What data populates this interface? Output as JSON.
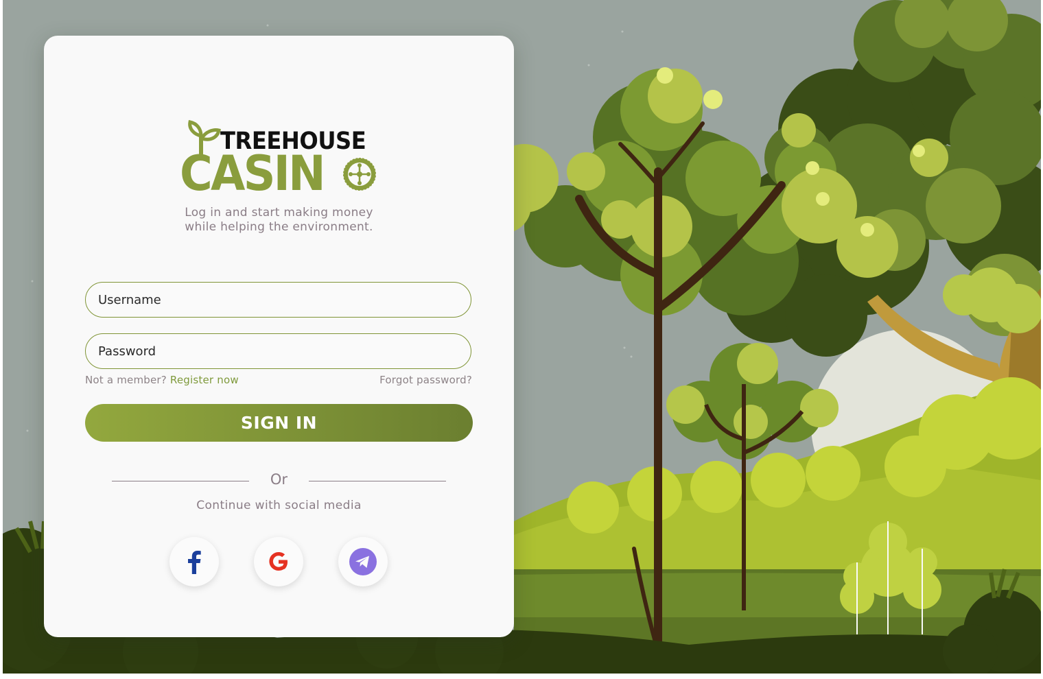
{
  "brand": {
    "top_word": "TREEHOUSE",
    "bottom_word": "CASIN",
    "colors": {
      "green": "#8a9d3d",
      "dark": "#111111"
    }
  },
  "tagline": {
    "line1": "Log in and start making money",
    "line2": "while helping the environment."
  },
  "form": {
    "username_placeholder": "Username",
    "password_placeholder": "Password",
    "not_member_text": "Not a member?",
    "register_label": "Register now",
    "forgot_label": "Forgot password?",
    "signin_label": "SIGN IN"
  },
  "social": {
    "or_label": "Or",
    "continue_label": "Continue with social media",
    "buttons": [
      {
        "name": "facebook",
        "icon": "facebook-icon",
        "color": "#1b3f9c"
      },
      {
        "name": "google",
        "icon": "google-icon",
        "color": "#e53222"
      },
      {
        "name": "telegram",
        "icon": "telegram-icon",
        "color": "#8a71e0"
      }
    ]
  },
  "theme": {
    "sky": "#9aa49f",
    "accent_green": "#7f9435",
    "card_bg": "#f9f9f9"
  }
}
